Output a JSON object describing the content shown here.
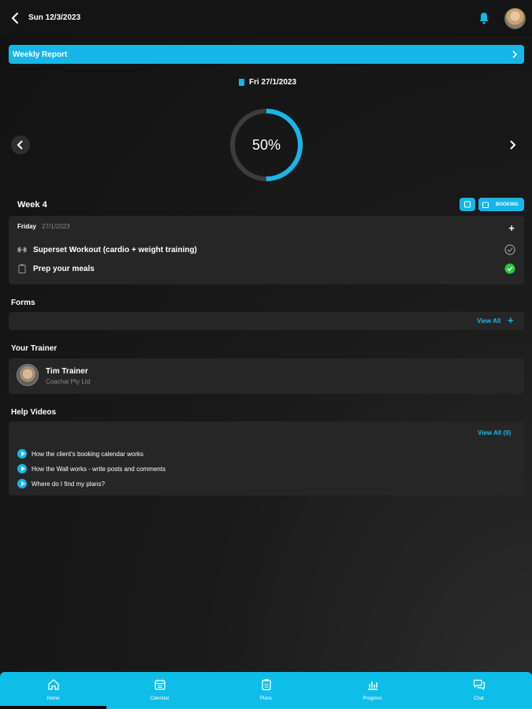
{
  "header": {
    "date": "Sun 12/3/2023"
  },
  "weekly_report": {
    "label": "Weekly Report"
  },
  "progress": {
    "date": "Fri 27/1/2023",
    "percent_label": "50%",
    "value": 0.5
  },
  "week": {
    "title": "Week 4",
    "booking_label": "BOOKING",
    "day": "Friday",
    "day_date": "27/1/2023",
    "tasks": [
      {
        "label": "Superset Workout (cardio + weight training)",
        "icon": "dumbbell-icon",
        "completed": false
      },
      {
        "label": "Prep your meals",
        "icon": "clipboard-icon",
        "completed": true
      }
    ]
  },
  "forms": {
    "title": "Forms",
    "view_all": "View All"
  },
  "trainer": {
    "title": "Your Trainer",
    "name": "Tim Trainer",
    "company": "Coachai Pty Ltd"
  },
  "help": {
    "title": "Help Videos",
    "view_all": "View All (9)",
    "videos": [
      "How the client's booking calendar works",
      "How the Wall works - write posts and comments",
      "Where do I find my plans?"
    ]
  },
  "nav": {
    "home": "Home",
    "calendar": "Calendar",
    "plans": "Plans",
    "progress": "Progress",
    "chat": "Chat"
  },
  "colors": {
    "accent": "#17b6e8",
    "success": "#27c93f",
    "card": "#262626"
  }
}
